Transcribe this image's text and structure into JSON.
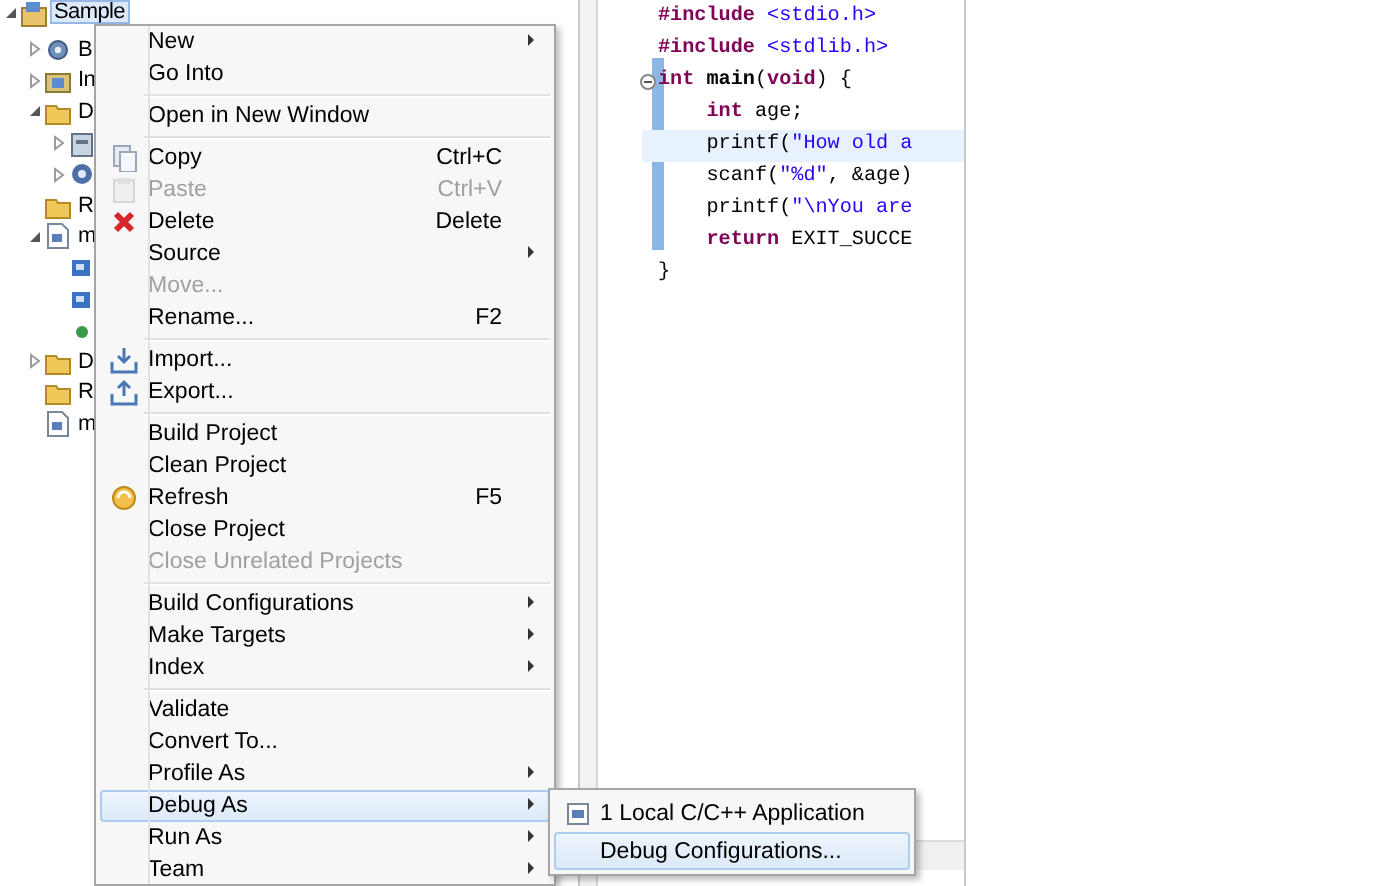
{
  "project_tree": [
    {
      "label": "Sample",
      "kind": "project",
      "expanded": true,
      "selected": true,
      "children": [
        {
          "label": "B",
          "kind": "binaries",
          "expanded": false,
          "selected": false
        },
        {
          "label": "In",
          "kind": "includes",
          "expanded": false,
          "selected": false
        },
        {
          "label": "D",
          "kind": "folder",
          "expanded": true,
          "selected": false,
          "children": [
            {
              "kind": "archive",
              "expanded": false,
              "selected": false
            },
            {
              "kind": "gear",
              "expanded": false,
              "selected": false
            }
          ]
        },
        {
          "label": "R",
          "kind": "folder",
          "selected": false
        },
        {
          "label": "m",
          "kind": "cfile",
          "expanded": true,
          "selected": false,
          "children": [
            {
              "kind": "method",
              "selected": false
            },
            {
              "kind": "method",
              "selected": false
            },
            {
              "kind": "variable",
              "selected": false
            }
          ]
        },
        {
          "label": "D",
          "kind": "folder",
          "expanded": false,
          "selected": false
        },
        {
          "label": "R",
          "kind": "folder",
          "selected": false
        },
        {
          "label": "m",
          "kind": "cfile",
          "selected": false
        }
      ]
    }
  ],
  "editor": {
    "lines": [
      {
        "current": false,
        "tokens": [
          {
            "kind": "keyword",
            "text": "#include"
          },
          {
            "kind": "string",
            "text": " <stdio.h>"
          }
        ]
      },
      {
        "current": false,
        "tokens": [
          {
            "kind": "keyword",
            "text": "#include"
          },
          {
            "kind": "string",
            "text": " <stdlib.h>"
          }
        ]
      },
      {
        "current": false,
        "expanded": true,
        "tokens": [
          {
            "kind": "keyword",
            "text": "int"
          },
          {
            "kind": "function",
            "text": " main"
          },
          {
            "kind": "plain",
            "text": "("
          },
          {
            "kind": "keyword",
            "text": "void"
          },
          {
            "kind": "plain",
            "text": ") {"
          }
        ]
      },
      {
        "current": false,
        "tokens": [
          {
            "kind": "keyword",
            "text": "    int"
          },
          {
            "kind": "plain",
            "text": " age;"
          }
        ]
      },
      {
        "current": true,
        "tokens": [
          {
            "kind": "plain",
            "text": "    printf("
          },
          {
            "kind": "string",
            "text": "\"How old a"
          }
        ]
      },
      {
        "current": false,
        "tokens": [
          {
            "kind": "plain",
            "text": "    scanf("
          },
          {
            "kind": "string",
            "text": "\"%d\""
          },
          {
            "kind": "plain",
            "text": ", &age)"
          }
        ]
      },
      {
        "current": false,
        "tokens": [
          {
            "kind": "plain",
            "text": "    printf("
          },
          {
            "kind": "string",
            "text": "\"\\nYou are"
          }
        ]
      },
      {
        "current": false,
        "tokens": [
          {
            "kind": "keyword",
            "text": "    return"
          },
          {
            "kind": "plain",
            "text": " EXIT_SUCCE"
          }
        ]
      },
      {
        "current": false,
        "tokens": [
          {
            "kind": "plain",
            "text": "}"
          }
        ]
      }
    ]
  },
  "context_menu": {
    "groups": [
      [
        {
          "label": "New",
          "submenu": true,
          "disabled": false,
          "selected": false
        },
        {
          "label": "Go Into",
          "submenu": false,
          "disabled": false,
          "selected": false
        }
      ],
      [
        {
          "label": "Open in New Window",
          "submenu": false,
          "disabled": false,
          "selected": false
        }
      ],
      [
        {
          "label": "Copy",
          "shortcut": "Ctrl+C",
          "submenu": false,
          "disabled": false,
          "selected": false
        },
        {
          "label": "Paste",
          "shortcut": "Ctrl+V",
          "submenu": false,
          "disabled": true,
          "selected": false
        },
        {
          "label": "Delete",
          "shortcut": "Delete",
          "submenu": false,
          "disabled": false,
          "selected": false
        },
        {
          "label": "Source",
          "submenu": true,
          "disabled": false,
          "selected": false
        },
        {
          "label": "Move...",
          "submenu": false,
          "disabled": true,
          "selected": false
        },
        {
          "label": "Rename...",
          "shortcut": "F2",
          "submenu": false,
          "disabled": false,
          "selected": false
        }
      ],
      [
        {
          "label": "Import...",
          "submenu": false,
          "disabled": false,
          "selected": false
        },
        {
          "label": "Export...",
          "submenu": false,
          "disabled": false,
          "selected": false
        }
      ],
      [
        {
          "label": "Build Project",
          "submenu": false,
          "disabled": false,
          "selected": false
        },
        {
          "label": "Clean Project",
          "submenu": false,
          "disabled": false,
          "selected": false
        },
        {
          "label": "Refresh",
          "shortcut": "F5",
          "submenu": false,
          "disabled": false,
          "selected": false
        },
        {
          "label": "Close Project",
          "submenu": false,
          "disabled": false,
          "selected": false
        },
        {
          "label": "Close Unrelated Projects",
          "submenu": false,
          "disabled": true,
          "selected": false
        }
      ],
      [
        {
          "label": "Build Configurations",
          "submenu": true,
          "disabled": false,
          "selected": false
        },
        {
          "label": "Make Targets",
          "submenu": true,
          "disabled": false,
          "selected": false
        },
        {
          "label": "Index",
          "submenu": true,
          "disabled": false,
          "selected": false
        }
      ],
      [
        {
          "label": "Validate",
          "submenu": false,
          "disabled": false,
          "selected": false
        },
        {
          "label": "Convert To...",
          "submenu": false,
          "disabled": false,
          "selected": false
        },
        {
          "label": "Profile As",
          "submenu": true,
          "disabled": false,
          "selected": false
        },
        {
          "label": "Debug As",
          "submenu": true,
          "disabled": false,
          "selected": true
        },
        {
          "label": "Run As",
          "submenu": true,
          "disabled": false,
          "selected": false
        },
        {
          "label": "Team",
          "submenu": true,
          "disabled": false,
          "selected": false
        }
      ]
    ]
  },
  "submenu": {
    "items": [
      {
        "label": "1 Local C/C++ Application",
        "selected": false
      },
      {
        "label": "Debug Configurations...",
        "selected": true
      }
    ]
  }
}
